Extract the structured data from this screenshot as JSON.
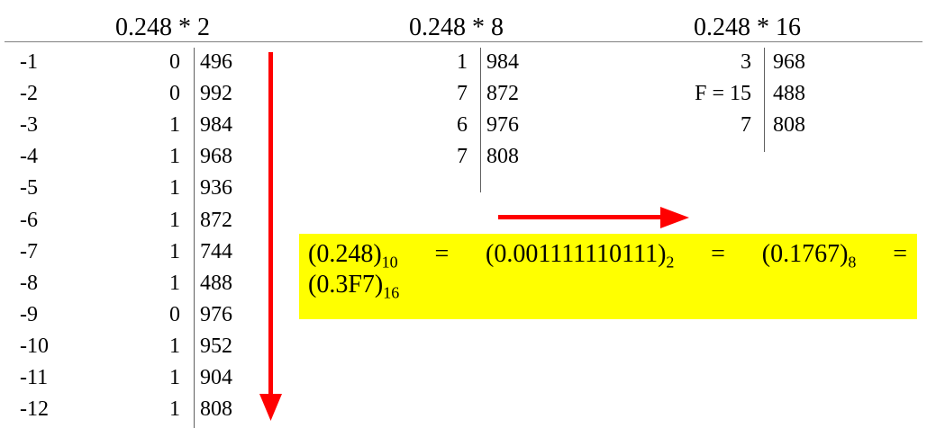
{
  "headers": {
    "binary": "0.248 * 2",
    "octal": "0.248 * 8",
    "hex": "0.248 * 16"
  },
  "binary_table": [
    {
      "pos": "-1",
      "digit": "0",
      "frac": "496"
    },
    {
      "pos": "-2",
      "digit": "0",
      "frac": "992"
    },
    {
      "pos": "-3",
      "digit": "1",
      "frac": "984"
    },
    {
      "pos": "-4",
      "digit": "1",
      "frac": "968"
    },
    {
      "pos": "-5",
      "digit": "1",
      "frac": "936"
    },
    {
      "pos": "-6",
      "digit": "1",
      "frac": "872"
    },
    {
      "pos": "-7",
      "digit": "1",
      "frac": "744"
    },
    {
      "pos": "-8",
      "digit": "1",
      "frac": "488"
    },
    {
      "pos": "-9",
      "digit": "0",
      "frac": "976"
    },
    {
      "pos": "-10",
      "digit": "1",
      "frac": "952"
    },
    {
      "pos": "-11",
      "digit": "1",
      "frac": "904"
    },
    {
      "pos": "-12",
      "digit": "1",
      "frac": "808"
    }
  ],
  "octal_table": [
    {
      "digit": "1",
      "frac": "984"
    },
    {
      "digit": "7",
      "frac": "872"
    },
    {
      "digit": "6",
      "frac": "976"
    },
    {
      "digit": "7",
      "frac": "808"
    }
  ],
  "hex_table": [
    {
      "digit": "3",
      "frac": "968"
    },
    {
      "digit": "F = 15",
      "frac": "488"
    },
    {
      "digit": "7",
      "frac": "808"
    }
  ],
  "result": {
    "dec_val": "(0.248)",
    "dec_base": "10",
    "eq1": "=",
    "bin_val": "(0.001111110111)",
    "bin_base": "2",
    "eq2": "=",
    "oct_val": "(0.1767)",
    "oct_base": "8",
    "eq3": "=",
    "hex_val": "(0.3F7)",
    "hex_base": "16"
  },
  "colors": {
    "arrow": "#ff0000",
    "highlight": "#ffff00"
  }
}
